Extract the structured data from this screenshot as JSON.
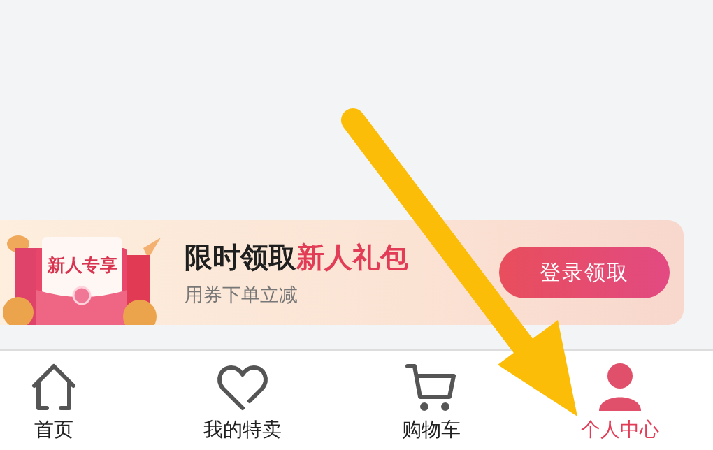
{
  "promo_banner": {
    "badge": "新人专享",
    "title": "限时领取**新人礼包**",
    "subtitle": "用券下单立减",
    "button": "登录领取"
  },
  "tabs": [
    {
      "kind": "home",
      "label": "首页",
      "selected": false
    },
    {
      "kind": "heart",
      "label": "我的特卖",
      "selected": false
    },
    {
      "kind": "cart",
      "label": "购物车",
      "selected": false
    },
    {
      "kind": "person",
      "label": "个人中心",
      "selected": true
    }
  ],
  "annotation": {
    "kind": "arrow"
  }
}
